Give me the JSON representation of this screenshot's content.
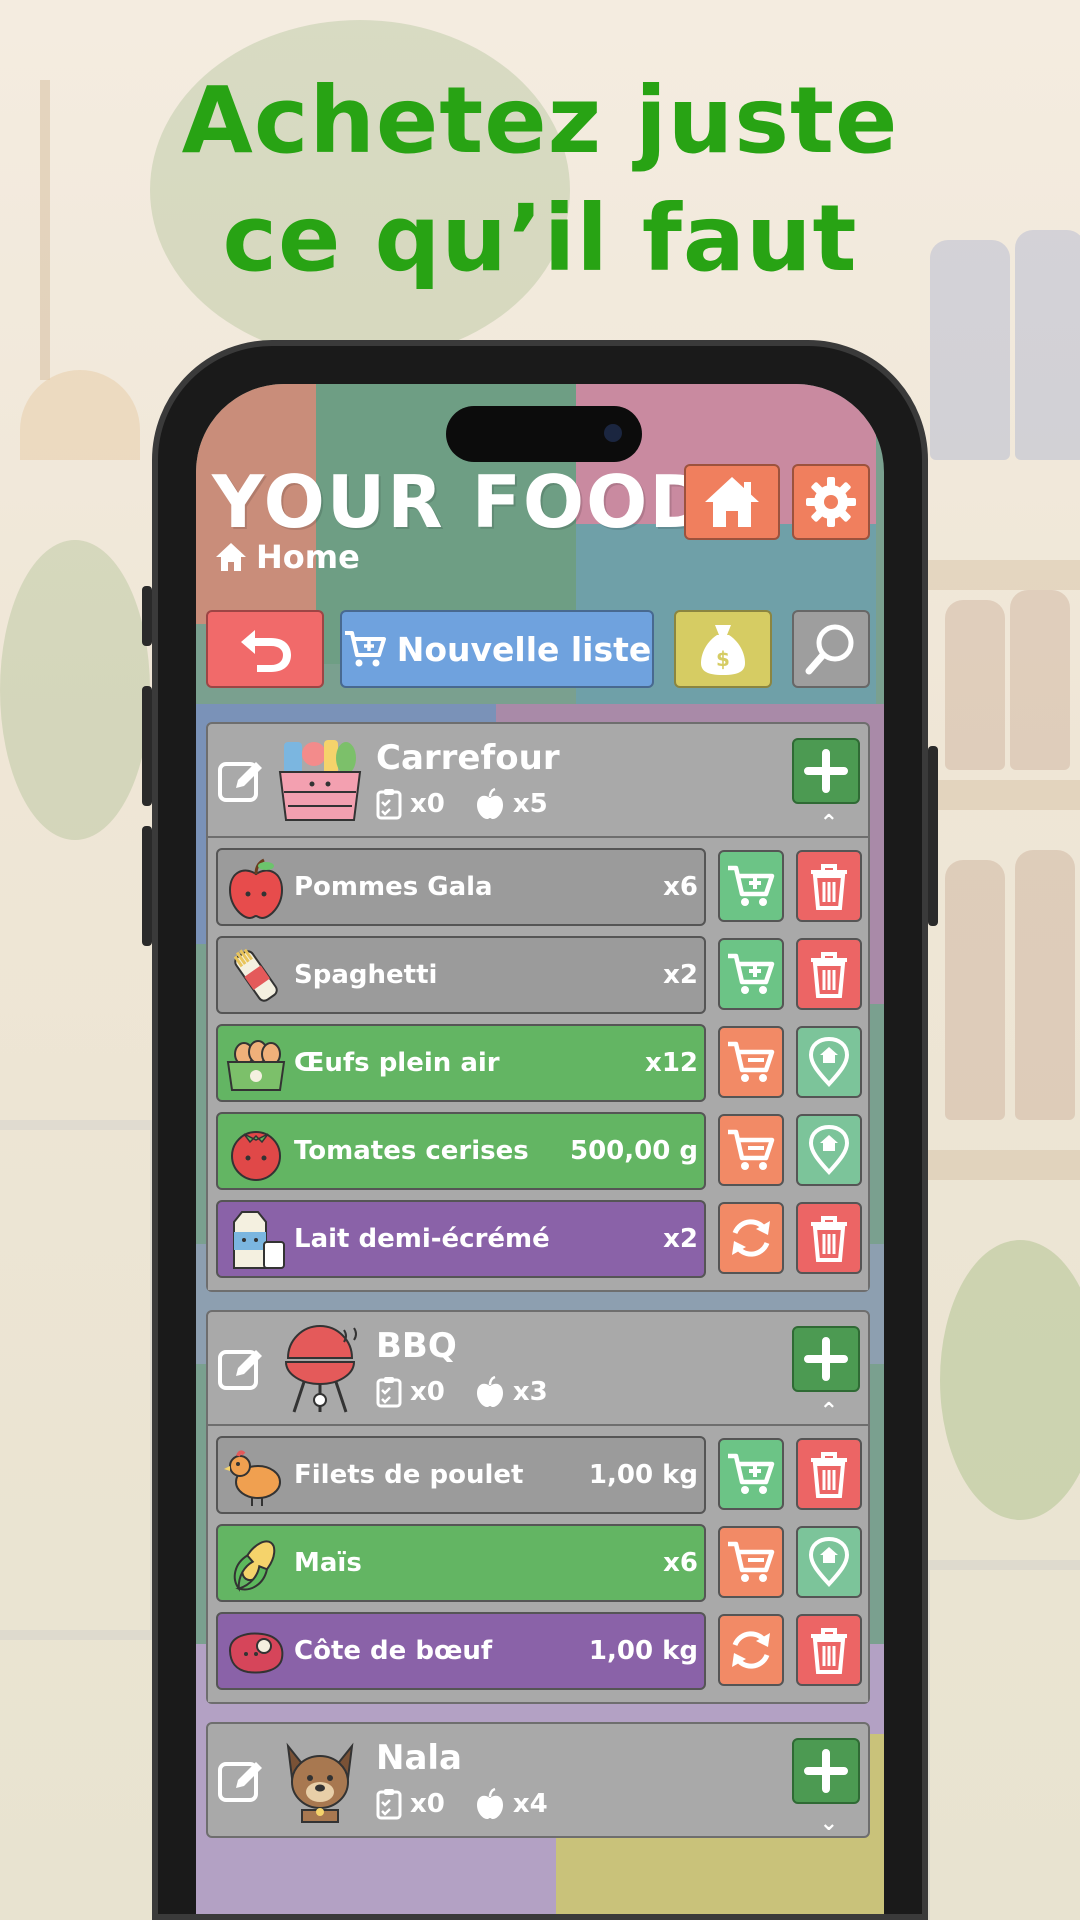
{
  "headline": {
    "line1": "Achetez juste",
    "line2": "ce qu’il faut"
  },
  "app": {
    "title": "YOUR FOOD",
    "breadcrumb": "Home",
    "toolbar": {
      "new_list_label": "Nouvelle liste"
    }
  },
  "groups": [
    {
      "name": "Carrefour",
      "icon": "shopping-basket-icon",
      "lists_count": "x0",
      "items_count": "x5",
      "items": [
        {
          "name": "Pommes Gala",
          "qty": "x6",
          "state": "grey",
          "icon": "apple-icon",
          "actions": [
            "add-to-cart",
            "delete"
          ]
        },
        {
          "name": "Spaghetti",
          "qty": "x2",
          "state": "grey",
          "icon": "pasta-icon",
          "actions": [
            "add-to-cart",
            "delete"
          ]
        },
        {
          "name": "Œufs plein air",
          "qty": "x12",
          "state": "green",
          "icon": "eggs-icon",
          "actions": [
            "cart",
            "location"
          ]
        },
        {
          "name": "Tomates cerises",
          "qty": "500,00 g",
          "state": "green",
          "icon": "tomato-icon",
          "actions": [
            "cart",
            "location"
          ]
        },
        {
          "name": "Lait demi-écrémé",
          "qty": "x2",
          "state": "purple",
          "icon": "milk-icon",
          "actions": [
            "refresh",
            "delete"
          ]
        }
      ]
    },
    {
      "name": "BBQ",
      "icon": "barbecue-icon",
      "lists_count": "x0",
      "items_count": "x3",
      "items": [
        {
          "name": "Filets de poulet",
          "qty": "1,00 kg",
          "state": "grey",
          "icon": "chicken-icon",
          "actions": [
            "add-to-cart",
            "delete"
          ]
        },
        {
          "name": "Maïs",
          "qty": "x6",
          "state": "green",
          "icon": "corn-icon",
          "actions": [
            "cart",
            "location"
          ]
        },
        {
          "name": "Côte de bœuf",
          "qty": "1,00 kg",
          "state": "purple",
          "icon": "steak-icon",
          "actions": [
            "refresh",
            "delete"
          ]
        }
      ]
    },
    {
      "name": "Nala",
      "icon": "dog-icon",
      "lists_count": "x0",
      "items_count": "x4",
      "items": []
    }
  ],
  "colors": {
    "headline": "#28a314",
    "home_button": "#f07f5e",
    "back_button": "#f16a6a",
    "new_list_button": "#6fa2de",
    "money_button": "#d6cc63",
    "item_grey": "#9b9b9b",
    "item_green": "#63b563",
    "item_purple": "#8a62a8"
  }
}
